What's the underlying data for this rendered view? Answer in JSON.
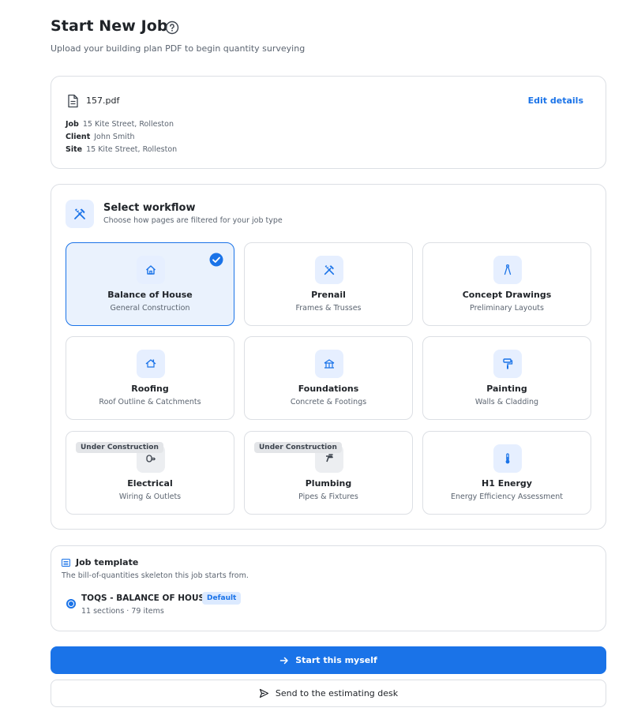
{
  "header": {
    "title": "Start New Job",
    "subtitle": "Upload your building plan PDF to begin quantity surveying"
  },
  "file": {
    "name": "157.pdf",
    "edit_label": "Edit details",
    "job_label": "Job",
    "job_value": "15 Kite Street, Rolleston",
    "client_label": "Client",
    "client_value": "John Smith",
    "site_label": "Site",
    "site_value": "15 Kite Street, Rolleston"
  },
  "workflow": {
    "title": "Select workflow",
    "subtitle": "Choose how pages are filtered for your job type",
    "tiles": [
      {
        "label": "Balance of House",
        "sub": "General Construction",
        "icon": "house-icon",
        "selected": true
      },
      {
        "label": "Prenail",
        "sub": "Frames & Trusses",
        "icon": "hammer-wrench-icon"
      },
      {
        "label": "Concept Drawings",
        "sub": "Preliminary Layouts",
        "icon": "compass-icon"
      },
      {
        "label": "Roofing",
        "sub": "Roof Outline & Catchments",
        "icon": "roof-icon"
      },
      {
        "label": "Foundations",
        "sub": "Concrete & Footings",
        "icon": "foundation-icon"
      },
      {
        "label": "Painting",
        "sub": "Walls & Cladding",
        "icon": "paint-roller-icon"
      },
      {
        "label": "Electrical",
        "sub": "Wiring & Outlets",
        "icon": "plug-icon",
        "badge": "Under Construction"
      },
      {
        "label": "Plumbing",
        "sub": "Pipes & Fixtures",
        "icon": "tap-icon",
        "badge": "Under Construction"
      },
      {
        "label": "H1 Energy",
        "sub": "Energy Efficiency Assessment",
        "icon": "thermometer-icon"
      }
    ]
  },
  "template": {
    "title": "Job template",
    "subtitle": "The bill-of-quantities skeleton this job starts from.",
    "name": "TOQS - BALANCE OF HOUSE",
    "badge": "Default",
    "meta": "11 sections · 79 items"
  },
  "actions": {
    "primary": "Start this myself",
    "secondary": "Send to the estimating desk"
  },
  "colors": {
    "accent": "#1a73e8",
    "accent_light": "#e6efff",
    "selected_bg": "#eaf2fd",
    "border": "#dcdfe4"
  }
}
